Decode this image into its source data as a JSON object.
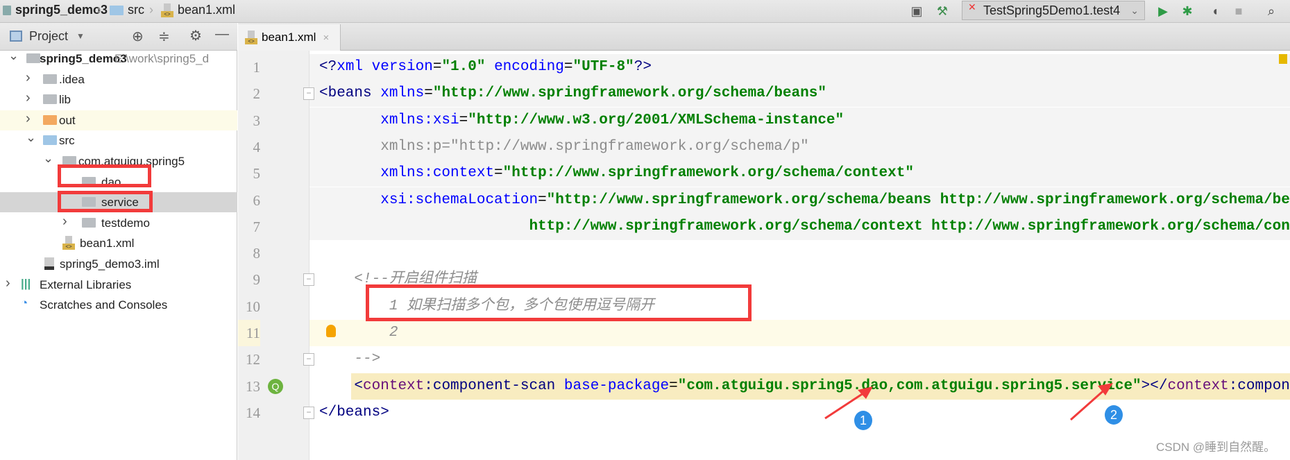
{
  "breadcrumb": [
    "spring5_demo3",
    "src",
    "bean1.xml"
  ],
  "toolbar": {
    "run_config": "TestSpring5Demo1.test4",
    "icons": [
      "window-icon",
      "hammer-icon",
      "run-icon",
      "debug-icon",
      "coverage-icon",
      "stop-icon",
      "search-icon"
    ]
  },
  "sidebar": {
    "title": "Project",
    "tree": [
      {
        "label": "spring5_demo3",
        "path": "E:\\work\\spring5_d",
        "icon": "module",
        "chevron": "open"
      },
      {
        "label": ".idea",
        "icon": "folder-gray",
        "chevron": "closed"
      },
      {
        "label": "lib",
        "icon": "folder-gray",
        "chevron": "closed"
      },
      {
        "label": "out",
        "icon": "folder-orange",
        "chevron": "closed"
      },
      {
        "label": "src",
        "icon": "folder-blue",
        "chevron": "open"
      },
      {
        "label": "com.atguigu.spring5",
        "icon": "package",
        "chevron": "open"
      },
      {
        "label": "dao",
        "icon": "package"
      },
      {
        "label": "service",
        "icon": "package",
        "selected": true
      },
      {
        "label": "testdemo",
        "icon": "package",
        "chevron": "closed"
      },
      {
        "label": "bean1.xml",
        "icon": "xml-file"
      },
      {
        "label": "spring5_demo3.iml",
        "icon": "iml-file"
      },
      {
        "label": "External Libraries",
        "icon": "libraries",
        "chevron": "closed"
      },
      {
        "label": "Scratches and Consoles",
        "icon": "scratches"
      }
    ]
  },
  "editor": {
    "tab": "bean1.xml",
    "lines": [
      [
        [
          "tag",
          "<?"
        ],
        [
          "attr",
          "xml version"
        ],
        [
          "txt",
          "="
        ],
        [
          "val",
          "\"1.0\""
        ],
        [
          "attr",
          " encoding"
        ],
        [
          "txt",
          "="
        ],
        [
          "val",
          "\"UTF-8\""
        ],
        [
          "tag",
          "?>"
        ]
      ],
      [
        [
          "tag",
          "<beans "
        ],
        [
          "attr",
          "xmlns"
        ],
        [
          "txt",
          "="
        ],
        [
          "val",
          "\"http://www.springframework.org/schema/beans\""
        ]
      ],
      [
        [
          "txt",
          "       "
        ],
        [
          "attr",
          "xmlns:xsi"
        ],
        [
          "txt",
          "="
        ],
        [
          "val",
          "\"http://www.w3.org/2001/XMLSchema-instance\""
        ]
      ],
      [
        [
          "txt",
          "       "
        ],
        [
          "unused",
          "xmlns:p=\"http://www.springframework.org/schema/p\""
        ]
      ],
      [
        [
          "txt",
          "       "
        ],
        [
          "attr",
          "xmlns:context"
        ],
        [
          "txt",
          "="
        ],
        [
          "val",
          "\"http://www.springframework.org/schema/context\""
        ]
      ],
      [
        [
          "txt",
          "       "
        ],
        [
          "attr",
          "xsi:schemaLocation"
        ],
        [
          "txt",
          "="
        ],
        [
          "val",
          "\"http://www.springframework.org/schema/beans http://www.springframework.org/schema/beans/spring-beans.xsd"
        ]
      ],
      [
        [
          "txt",
          "                        "
        ],
        [
          "val",
          "http://www.springframework.org/schema/context http://www.springframework.org/schema/context/spring-context.xsd\">"
        ]
      ],
      [],
      [
        [
          "txt",
          "    "
        ],
        [
          "cmt",
          "<!--开启组件扫描"
        ]
      ],
      [
        [
          "txt",
          "        "
        ],
        [
          "cmt",
          "1 如果扫描多个包，多个包使用逗号隔开"
        ]
      ],
      [
        [
          "txt",
          "        "
        ],
        [
          "cmt",
          "2"
        ]
      ],
      [
        [
          "txt",
          "    "
        ],
        [
          "cmt",
          "-->"
        ]
      ],
      [
        [
          "txt",
          "    "
        ],
        [
          "tag",
          "<"
        ],
        [
          "ns",
          "context"
        ],
        [
          "tag",
          ":component-scan "
        ],
        [
          "attr",
          "base-package"
        ],
        [
          "txt",
          "="
        ],
        [
          "val",
          "\"com.atguigu.spring5.dao,com.atguigu.spring5.service\""
        ],
        [
          "tag",
          "></"
        ],
        [
          "ns",
          "context"
        ],
        [
          "tag",
          ":component-scan>"
        ]
      ],
      [
        [
          "tag",
          "</beans>"
        ]
      ]
    ]
  },
  "annotations": {
    "badges": [
      "1",
      "2"
    ],
    "colors": {
      "highlight": "#f23b3b",
      "badge": "#2f8fe6"
    }
  },
  "watermark": "CSDN @睡到自然醒。"
}
